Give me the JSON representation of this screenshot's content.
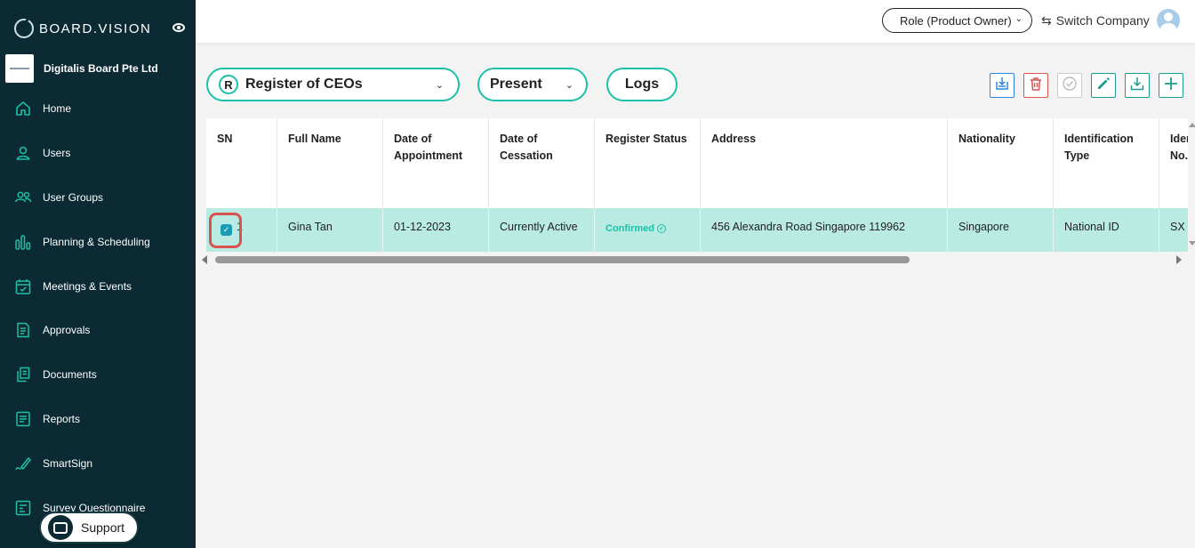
{
  "app": {
    "logo_text": "BOARD.VISION"
  },
  "company": {
    "name": "Digitalis Board Pte Ltd"
  },
  "sidebar": {
    "items": [
      {
        "label": "Home",
        "icon": "home-icon"
      },
      {
        "label": "Users",
        "icon": "user-icon"
      },
      {
        "label": "User Groups",
        "icon": "users-icon"
      },
      {
        "label": "Planning & Scheduling",
        "icon": "chart-bars-icon"
      },
      {
        "label": "Meetings & Events",
        "icon": "calendar-check-icon"
      },
      {
        "label": "Approvals",
        "icon": "document-list-icon"
      },
      {
        "label": "Documents",
        "icon": "documents-icon"
      },
      {
        "label": "Reports",
        "icon": "report-icon"
      },
      {
        "label": "SmartSign",
        "icon": "signature-pen-icon"
      },
      {
        "label": "Survey Questionnaire",
        "icon": "survey-icon"
      }
    ]
  },
  "support": {
    "label": "Support"
  },
  "header": {
    "role_label": "Role (Product Owner)",
    "switch_company_label": "Switch Company"
  },
  "filters": {
    "register_badge": "R",
    "register_label": "Register of CEOs",
    "period_label": "Present",
    "logs_label": "Logs"
  },
  "toolbar": {
    "import_icon": "import-icon",
    "delete_icon": "trash-icon",
    "approve_icon": "check-circle-icon",
    "edit_icon": "pencil-icon",
    "download_icon": "download-icon",
    "add_icon": "plus-icon"
  },
  "colors": {
    "sidebar_bg": "#0b2a33",
    "accent": "#1cc0a8",
    "selected_row": "#b9ebe2",
    "danger": "#d9534f"
  },
  "table": {
    "columns": [
      {
        "label": "SN"
      },
      {
        "label": "Full Name"
      },
      {
        "label": "Date of Appointment"
      },
      {
        "label": "Date of Cessation"
      },
      {
        "label": "Register Status"
      },
      {
        "label": "Address"
      },
      {
        "label": "Nationality"
      },
      {
        "label": "Identification Type"
      },
      {
        "label": "Identification No."
      }
    ],
    "rows": [
      {
        "sn": "1",
        "full_name": "Gina Tan",
        "date_of_appointment": "01-12-2023",
        "date_of_cessation": "Currently Active",
        "register_status": "Confirmed",
        "address": "456 Alexandra Road Singapore 119962",
        "nationality": "Singapore",
        "identification_type": "National ID",
        "identification_no": "SX"
      }
    ]
  }
}
